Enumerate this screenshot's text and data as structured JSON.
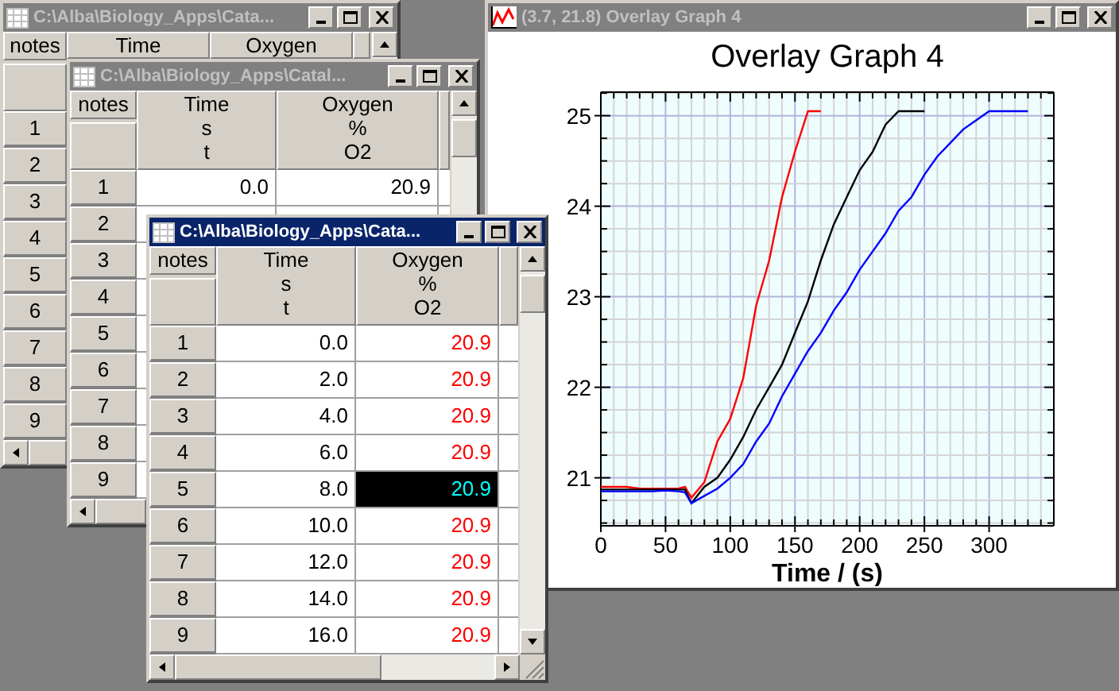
{
  "windows": [
    {
      "kind": "table",
      "title": "C:\\Alba\\Biology_Apps\\Cata...",
      "active": false,
      "notes_label": "notes",
      "columns": [
        {
          "name": "Time"
        },
        {
          "name": "Oxygen"
        }
      ],
      "rows": [
        {
          "label": "1"
        },
        {
          "label": "2"
        },
        {
          "label": "3"
        },
        {
          "label": "4"
        },
        {
          "label": "5"
        },
        {
          "label": "6"
        },
        {
          "label": "7"
        },
        {
          "label": "8"
        },
        {
          "label": "9"
        }
      ]
    },
    {
      "kind": "table",
      "title": "C:\\Alba\\Biology_Apps\\Catal...",
      "active": false,
      "notes_label": "notes",
      "columns": [
        {
          "name": "Time",
          "unit": "s",
          "symbol": "t",
          "color": "#000000"
        },
        {
          "name": "Oxygen",
          "unit": "%",
          "symbol": "O2",
          "color": "#000000"
        }
      ],
      "rows": [
        {
          "label": "1",
          "cells": [
            "0.0",
            "20.9"
          ]
        },
        {
          "label": "2"
        },
        {
          "label": "3"
        },
        {
          "label": "4"
        },
        {
          "label": "5"
        },
        {
          "label": "6"
        },
        {
          "label": "7"
        },
        {
          "label": "8"
        },
        {
          "label": "9"
        }
      ]
    },
    {
      "kind": "table",
      "title": "C:\\Alba\\Biology_Apps\\Cata...",
      "active": true,
      "notes_label": "notes",
      "columns": [
        {
          "name": "Time",
          "unit": "s",
          "symbol": "t",
          "color": "#000000"
        },
        {
          "name": "Oxygen",
          "unit": "%",
          "symbol": "O2",
          "color": "#ff0000"
        }
      ],
      "rows": [
        {
          "label": "1",
          "cells": [
            "0.0",
            "20.9"
          ],
          "selected": false
        },
        {
          "label": "2",
          "cells": [
            "2.0",
            "20.9"
          ],
          "selected": false
        },
        {
          "label": "3",
          "cells": [
            "4.0",
            "20.9"
          ],
          "selected": false
        },
        {
          "label": "4",
          "cells": [
            "6.0",
            "20.9"
          ],
          "selected": false
        },
        {
          "label": "5",
          "cells": [
            "8.0",
            "20.9"
          ],
          "selected": true
        },
        {
          "label": "6",
          "cells": [
            "10.0",
            "20.9"
          ],
          "selected": false
        },
        {
          "label": "7",
          "cells": [
            "12.0",
            "20.9"
          ],
          "selected": false
        },
        {
          "label": "8",
          "cells": [
            "14.0",
            "20.9"
          ],
          "selected": false
        },
        {
          "label": "9",
          "cells": [
            "16.0",
            "20.9"
          ],
          "selected": false
        }
      ]
    },
    {
      "kind": "graph",
      "title": "(3.7, 21.8) Overlay Graph 4",
      "active": false,
      "chart_data": {
        "type": "line",
        "grid": true,
        "title": "Overlay Graph 4",
        "xlabel": "Time / (s)",
        "xlim": [
          0,
          350
        ],
        "ylim": [
          20.47,
          25.26
        ],
        "xticks": [
          0,
          50,
          100,
          150,
          200,
          250,
          300
        ],
        "yticks": [
          21,
          22,
          23,
          24,
          25
        ],
        "x": [
          0,
          10,
          20,
          30,
          40,
          50,
          60,
          65,
          70,
          80,
          90,
          100,
          110,
          120,
          130,
          140,
          150,
          160,
          170,
          180,
          190,
          200,
          210,
          220,
          230,
          240,
          250,
          260,
          270,
          280,
          290,
          300,
          310,
          320,
          330
        ],
        "series": [
          {
            "color": "#ff0000",
            "values": [
              20.9,
              20.9,
              20.9,
              20.88,
              20.88,
              20.88,
              20.88,
              20.9,
              20.78,
              20.95,
              21.4,
              21.65,
              22.1,
              22.9,
              23.4,
              24.1,
              24.6,
              25.05,
              25.05,
              null,
              null,
              null,
              null,
              null,
              null,
              null,
              null,
              null,
              null,
              null,
              null,
              null,
              null,
              null,
              null
            ]
          },
          {
            "color": "#000000",
            "values": [
              20.87,
              20.87,
              20.87,
              20.87,
              20.87,
              20.87,
              20.87,
              20.87,
              20.72,
              20.9,
              21.0,
              21.2,
              21.45,
              21.75,
              22.0,
              22.25,
              22.6,
              22.95,
              23.4,
              23.8,
              24.1,
              24.4,
              24.6,
              24.9,
              25.05,
              25.05,
              25.05,
              null,
              null,
              null,
              null,
              null,
              null,
              null,
              null
            ]
          },
          {
            "color": "#0000ff",
            "values": [
              20.85,
              20.85,
              20.85,
              20.85,
              20.85,
              20.86,
              20.85,
              20.84,
              20.72,
              20.8,
              20.88,
              21.0,
              21.15,
              21.4,
              21.6,
              21.9,
              22.15,
              22.4,
              22.6,
              22.85,
              23.05,
              23.3,
              23.5,
              23.7,
              23.95,
              24.1,
              24.35,
              24.55,
              24.7,
              24.85,
              24.95,
              25.05,
              25.05,
              25.05,
              25.05
            ]
          }
        ]
      }
    }
  ]
}
